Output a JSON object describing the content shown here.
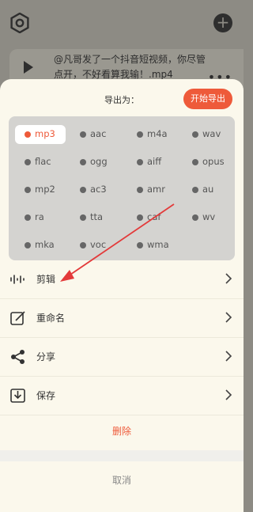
{
  "background": {
    "gear_icon": "gear-icon",
    "add_button": "+",
    "audio_title": "@凡哥发了一个抖音短视频，你尽管点开，不好看算我输！.mp4",
    "more": "•••"
  },
  "sheet": {
    "export_label": "导出为：",
    "start_export": "开始导出",
    "formats": [
      "mp3",
      "aac",
      "m4a",
      "wav",
      "flac",
      "ogg",
      "aiff",
      "opus",
      "mp2",
      "ac3",
      "amr",
      "au",
      "ra",
      "tta",
      "caf",
      "wv",
      "mka",
      "voc",
      "wma"
    ],
    "selected_format": "mp3",
    "actions": [
      {
        "label": "剪辑",
        "icon": "waveform-icon"
      },
      {
        "label": "重命名",
        "icon": "edit-icon"
      },
      {
        "label": "分享",
        "icon": "share-icon"
      },
      {
        "label": "保存",
        "icon": "download-icon"
      }
    ],
    "delete_label": "删除",
    "cancel_label": "取消"
  },
  "colors": {
    "accent": "#ee5a3a",
    "sheet": "#fbf8ec",
    "grid_bg": "#d4d3d0"
  }
}
